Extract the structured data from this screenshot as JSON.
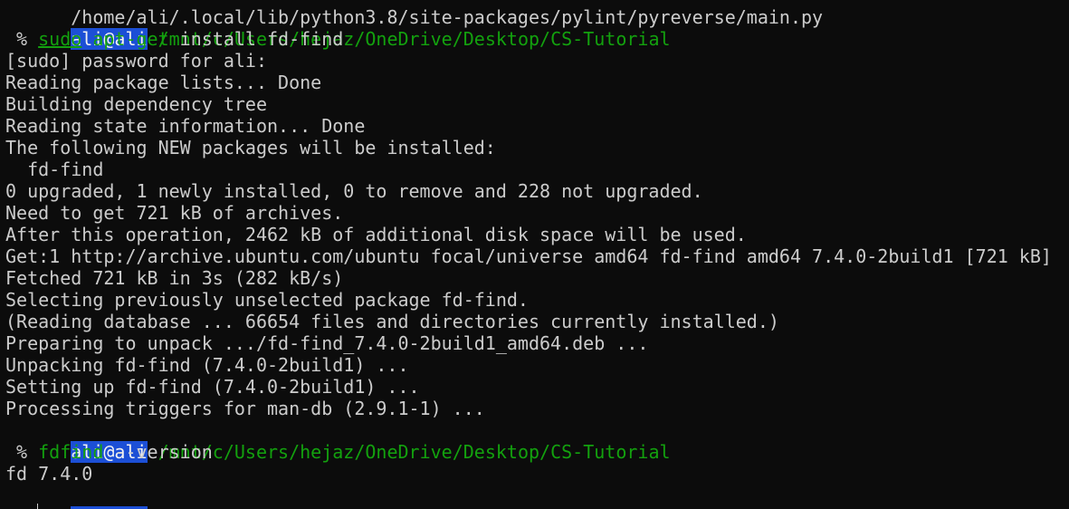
{
  "colors": {
    "background": "#0c0c0c",
    "foreground": "#cccccc",
    "path_green": "#13a10e",
    "prompt_highlight": "#1c4fd6"
  },
  "terminal": {
    "partial_top_line": "/home/ali/.local/lib/python3.8/site-packages/pylint/pyreverse/main.py",
    "prompt_user": "ali@ali",
    "cwd": "/mnt/c/Users/hejaz/OneDrive/Desktop/CS-Tutorial",
    "prompt_symbol": " % ",
    "command1": {
      "sudo": "sudo",
      "apt": "apt-get",
      "args": " install fd-find"
    },
    "output1": [
      "[sudo] password for ali:",
      "Reading package lists... Done",
      "Building dependency tree",
      "Reading state information... Done",
      "The following NEW packages will be installed:",
      "  fd-find",
      "0 upgraded, 1 newly installed, 0 to remove and 228 not upgraded.",
      "Need to get 721 kB of archives.",
      "After this operation, 2462 kB of additional disk space will be used.",
      "Get:1 http://archive.ubuntu.com/ubuntu focal/universe amd64 fd-find amd64 7.4.0-2build1 [721 kB]",
      "Fetched 721 kB in 3s (282 kB/s)",
      "Selecting previously unselected package fd-find.",
      "(Reading database ... 66654 files and directories currently installed.)",
      "Preparing to unpack .../fd-find_7.4.0-2build1_amd64.deb ...",
      "Unpacking fd-find (7.4.0-2build1) ...",
      "Setting up fd-find (7.4.0-2build1) ...",
      "Processing triggers for man-db (2.9.1-1) ..."
    ],
    "command2": {
      "cmd": "fdfind",
      "args": " --version"
    },
    "output2": "fd 7.4.0"
  }
}
